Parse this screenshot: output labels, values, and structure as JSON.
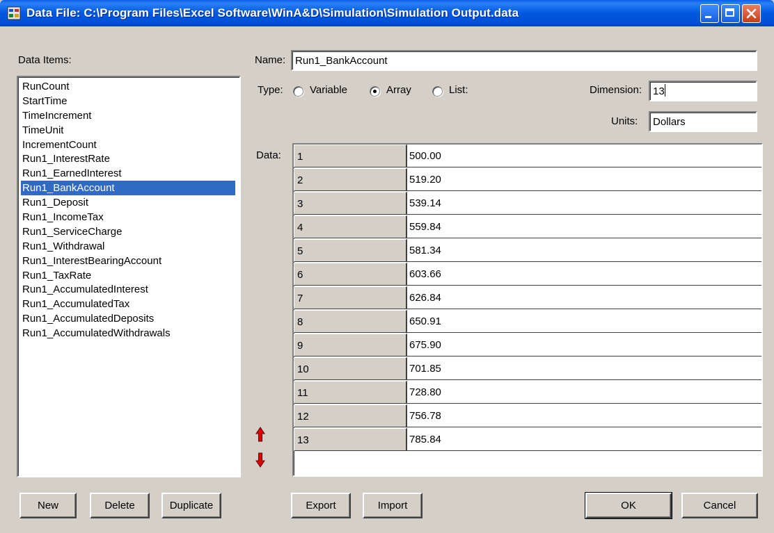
{
  "window": {
    "title": "Data File: C:\\Program Files\\Excel Software\\WinA&D\\Simulation\\Simulation Output.data"
  },
  "left": {
    "data_items_label": "Data Items:",
    "items": [
      "RunCount",
      "StartTime",
      "TimeIncrement",
      "TimeUnit",
      "IncrementCount",
      "Run1_InterestRate",
      "Run1_EarnedInterest",
      "Run1_BankAccount",
      "Run1_Deposit",
      "Run1_IncomeTax",
      "Run1_ServiceCharge",
      "Run1_Withdrawal",
      "Run1_InterestBearingAccount",
      "Run1_TaxRate",
      "Run1_AccumulatedInterest",
      "Run1_AccumulatedTax",
      "Run1_AccumulatedDeposits",
      "Run1_AccumulatedWithdrawals"
    ],
    "selected_index": 7
  },
  "form": {
    "name_label": "Name:",
    "name_value": "Run1_BankAccount",
    "type_label": "Type:",
    "type_options": [
      "Variable",
      "Array",
      "List:"
    ],
    "type_selected": "Array",
    "dimension_label": "Dimension:",
    "dimension_value": "13",
    "units_label": "Units:",
    "units_value": "Dollars",
    "data_label": "Data:"
  },
  "grid": {
    "rows": [
      {
        "index": "1",
        "value": "500.00"
      },
      {
        "index": "2",
        "value": "519.20"
      },
      {
        "index": "3",
        "value": "539.14"
      },
      {
        "index": "4",
        "value": "559.84"
      },
      {
        "index": "5",
        "value": "581.34"
      },
      {
        "index": "6",
        "value": "603.66"
      },
      {
        "index": "7",
        "value": "626.84"
      },
      {
        "index": "8",
        "value": "650.91"
      },
      {
        "index": "9",
        "value": "675.90"
      },
      {
        "index": "10",
        "value": "701.85"
      },
      {
        "index": "11",
        "value": "728.80"
      },
      {
        "index": "12",
        "value": "756.78"
      },
      {
        "index": "13",
        "value": "785.84"
      }
    ]
  },
  "buttons": {
    "new": "New",
    "delete": "Delete",
    "duplicate": "Duplicate",
    "export": "Export",
    "import": "Import",
    "ok": "OK",
    "cancel": "Cancel"
  },
  "colors": {
    "selection": "#316ac5",
    "arrow": "#e00000",
    "titlebar": "#0058e2"
  }
}
